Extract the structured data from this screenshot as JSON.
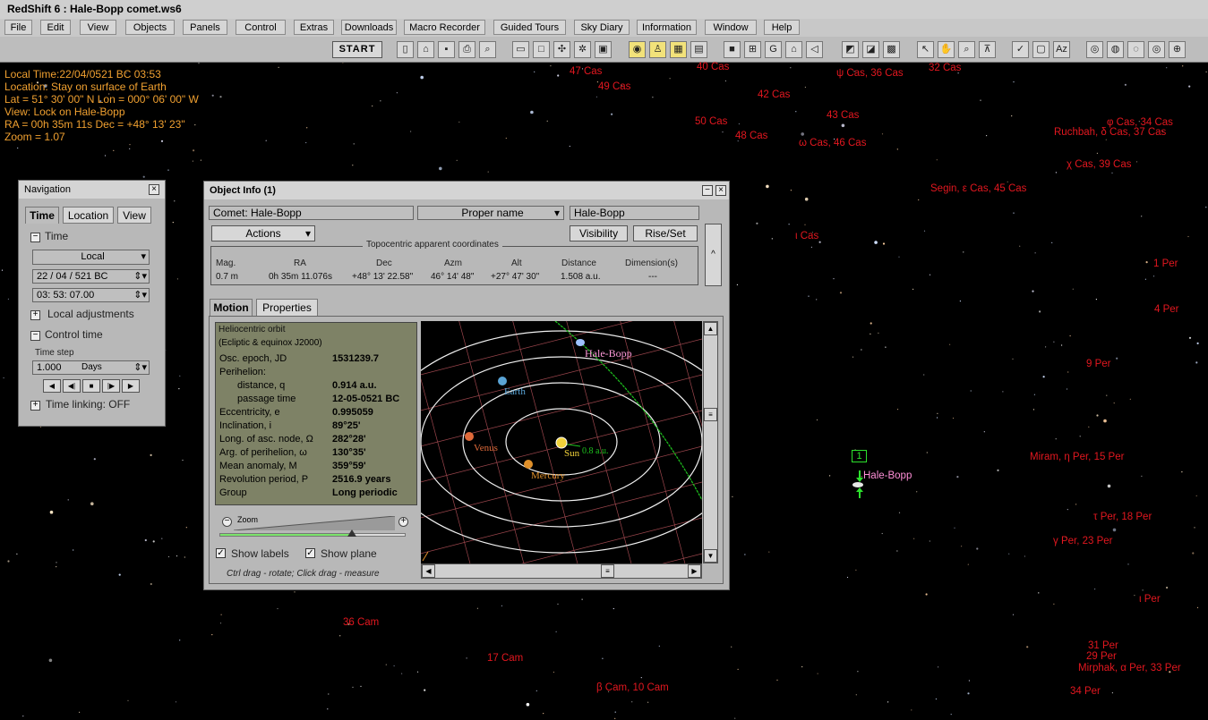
{
  "window": {
    "title": "RedShift 6 : Hale-Bopp comet.ws6"
  },
  "menu": [
    "File",
    "Edit",
    "View",
    "Objects",
    "Panels",
    "Control",
    "Extras",
    "Downloads",
    "Macro Recorder",
    "Guided Tours",
    "Sky Diary",
    "Information",
    "Window",
    "Help"
  ],
  "toolbar": {
    "start_label": "START"
  },
  "hud": {
    "local_time": "Local Time:22/04/0521 BC 03:53",
    "location": "Location: Stay on surface of Earth",
    "latlon": "Lat = 51° 30' 00\" N   Lon = 000° 06' 00\" W",
    "view": "View: Lock on Hale-Bopp",
    "radec": "RA = 00h 35m 11s  Dec = +48° 13' 23\"",
    "zoom": "Zoom = 1.07"
  },
  "star_labels": [
    "47 Cas",
    "40 Cas",
    "ψ Cas, 36 Cas",
    "32 Cas",
    "49 Cas",
    "42 Cas",
    "43 Cas",
    "50 Cas",
    "48 Cas",
    "ω Cas, 46 Cas",
    "φ Cas, 34 Cas",
    "Ruchbah, δ Cas, 37 Cas",
    "χ Cas, 39 Cas",
    "Segin, ε Cas, 45 Cas",
    "ι Cas",
    "1 Per",
    "4 Per",
    "9 Per",
    "Miram, η Per, 15 Per",
    "τ Per, 18 Per",
    "γ Per, 23 Per",
    "ι Per",
    "31 Per",
    "29 Per",
    "Mirphak, α Per, 33 Per",
    "34 Per",
    "36 Cam",
    "17 Cam",
    "β Cam, 10 Cam",
    "Hale-Bopp"
  ],
  "target_marker": "1",
  "navigation": {
    "title": "Navigation",
    "tabs": [
      "Time",
      "Location",
      "View"
    ],
    "time_group": "Time",
    "time_mode": "Local",
    "date": "22 / 04 / 521    BC",
    "time": "03:  53: 07.00",
    "local_adjustments": "Local adjustments",
    "control_time": "Control time",
    "time_step_label": "Time step",
    "time_step_value": "1.000",
    "time_step_unit": "Days",
    "time_linking": "Time linking: OFF"
  },
  "object_info": {
    "title": "Object Info (1)",
    "object_type": "Comet: Hale-Bopp",
    "name_mode": "Proper name",
    "name": "Hale-Bopp",
    "actions": "Actions",
    "visibility": "Visibility",
    "rise_set": "Rise/Set",
    "coords_caption": "Topocentric apparent coordinates",
    "coord_headers": [
      "Mag.",
      "RA",
      "Dec",
      "Azm",
      "Alt",
      "Distance",
      "Dimension(s)"
    ],
    "coord_values": [
      "0.7 m",
      "0h 35m 11.076s",
      "+48° 13' 22.58\"",
      "46° 14' 48\"",
      "+27° 47' 30\"",
      "1.508 a.u.",
      "---"
    ],
    "tabs": [
      "Motion",
      "Properties"
    ],
    "orbit_title": "Heliocentric orbit",
    "orbit_subtitle": "(Ecliptic & equinox J2000)",
    "orbit_rows": [
      {
        "k": "Osc. epoch, JD",
        "v": "1531239.7"
      },
      {
        "k": "Perihelion:",
        "v": ""
      },
      {
        "k": "     distance, q",
        "v": "0.914 a.u."
      },
      {
        "k": "     passage time",
        "v": "12-05-0521 BC"
      },
      {
        "k": "Eccentricity, e",
        "v": "0.995059"
      },
      {
        "k": "Inclination, i",
        "v": "89°25'"
      },
      {
        "k": "Long. of asc. node, Ω",
        "v": "282°28'"
      },
      {
        "k": "Arg. of perihelion, ω",
        "v": "130°35'"
      },
      {
        "k": "Mean anomaly, M",
        "v": "359°59'"
      },
      {
        "k": "Revolution period, P",
        "v": "2516.9 years"
      },
      {
        "k": "Group",
        "v": "Long periodic"
      }
    ],
    "zoom_label": "Zoom",
    "zoom_level": 0.71,
    "show_labels": "Show labels",
    "show_plane": "Show plane",
    "hint": "Ctrl drag - rotate; Click drag - measure",
    "diagram_labels": {
      "comet": "Hale-Bopp",
      "earth": "Earth",
      "venus": "Venus",
      "mercury": "Mercury",
      "sun": "Sun",
      "scale": "0.8 a.u."
    }
  }
}
